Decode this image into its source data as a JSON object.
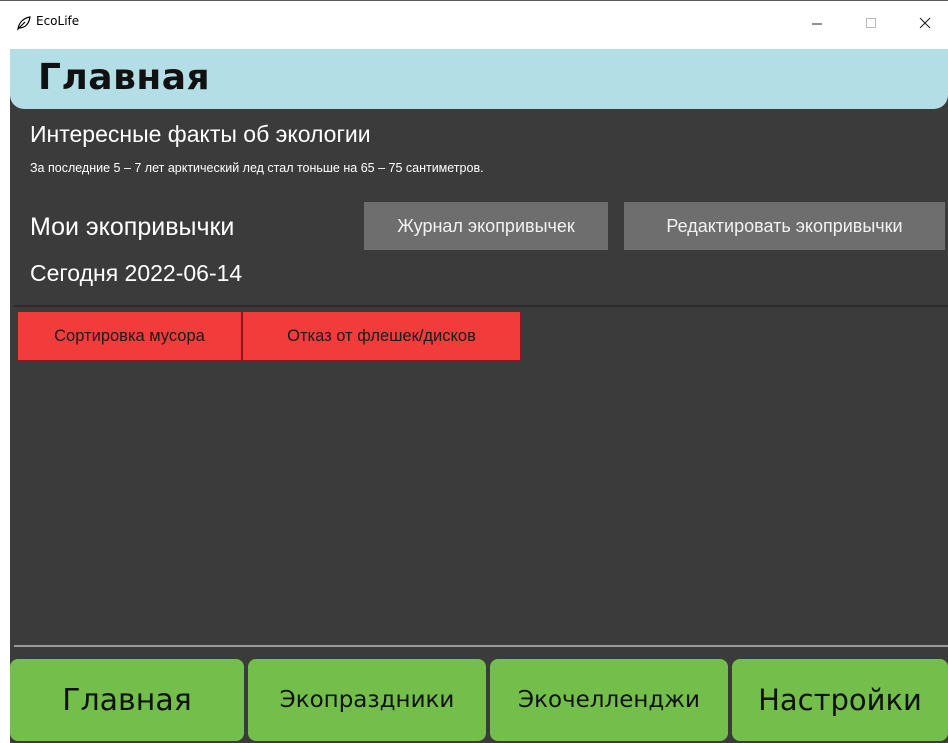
{
  "window": {
    "title": "EcoLife",
    "icon": "leaf-icon",
    "controls": [
      "minimize-icon",
      "maximize-icon",
      "close-icon"
    ]
  },
  "header": {
    "title": "Главная"
  },
  "facts": {
    "title": "Интересные факты об экологии",
    "text": "За последние 5 – 7 лет арктический лед стал тоньше на 65 – 75 сантиметров."
  },
  "habits": {
    "title": "Мои экопривычки",
    "journal_button": "Журнал экопривычек",
    "edit_button": "Редактировать экопривычки",
    "today_label": "Сегодня 2022-06-14",
    "items": [
      {
        "label": "Сортировка мусора"
      },
      {
        "label": "Отказ от флешек/дисков"
      }
    ]
  },
  "nav": {
    "items": [
      {
        "label": "Главная"
      },
      {
        "label": "Экопраздники"
      },
      {
        "label": "Экочелленджи"
      },
      {
        "label": "Настройки"
      }
    ]
  },
  "colors": {
    "header_bg": "#b3dee6",
    "app_bg": "#3b3b3b",
    "button_gray": "#6e6e6e",
    "habit_red": "#f23c3c",
    "nav_green": "#74bf4c"
  }
}
